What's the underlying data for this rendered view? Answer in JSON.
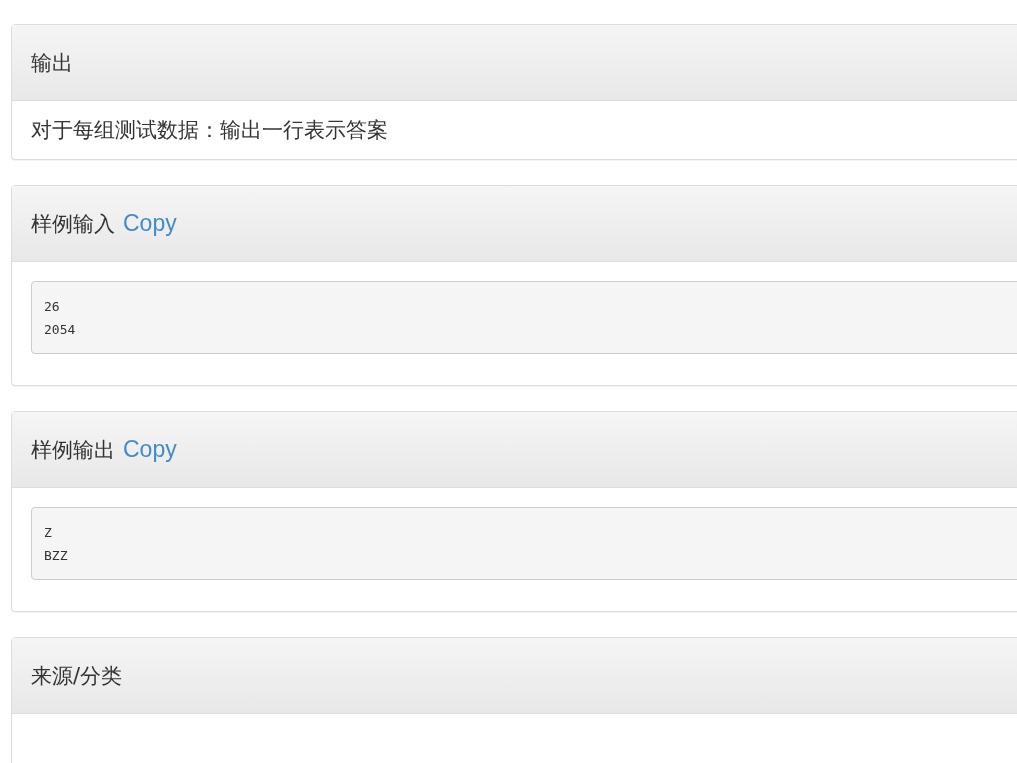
{
  "panels": [
    {
      "heading": "输出",
      "body": {
        "kind": "text",
        "text": "对于每组测试数据：输出一行表示答案"
      }
    },
    {
      "heading": "样例输入",
      "copy_link": "Copy",
      "body": {
        "kind": "code",
        "lines": [
          "26",
          "2054"
        ]
      }
    },
    {
      "heading": "样例输出",
      "copy_link": "Copy",
      "body": {
        "kind": "code",
        "lines": [
          "Z",
          "BZZ"
        ]
      }
    },
    {
      "heading": "来源/分类"
    }
  ]
}
